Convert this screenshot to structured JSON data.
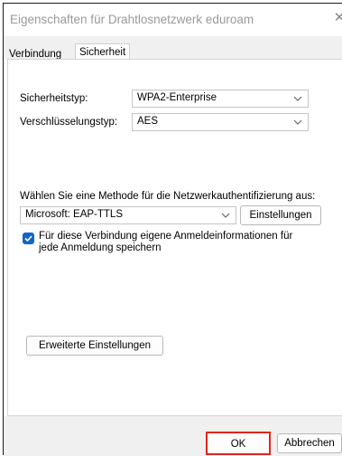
{
  "window": {
    "title": "Eigenschaften für Drahtlosnetzwerk eduroam",
    "close_glyph": "✕"
  },
  "tabs": [
    {
      "label": "Verbindung",
      "selected": false
    },
    {
      "label": "Sicherheit",
      "selected": true
    }
  ],
  "security": {
    "security_type_label": "Sicherheitstyp:",
    "security_type_value": "WPA2-Enterprise",
    "encryption_type_label": "Verschlüsselungstyp:",
    "encryption_type_value": "AES"
  },
  "auth": {
    "method_prompt": "Wählen Sie eine Methode für die Netzwerkauthentifizierung aus:",
    "method_value": "Microsoft: EAP-TTLS",
    "settings_button": "Einstellungen",
    "remember_checked": true,
    "remember_label_line1": "Für diese Verbindung eigene Anmeldeinformationen für",
    "remember_label_line2": "jede Anmeldung speichern"
  },
  "advanced_button": "Erweiterte Einstellungen",
  "footer": {
    "ok_button": "OK",
    "cancel_button": "Abbrechen"
  },
  "colors": {
    "checkbox_accent": "#1565c0",
    "ok_highlight": "#e0251b"
  }
}
